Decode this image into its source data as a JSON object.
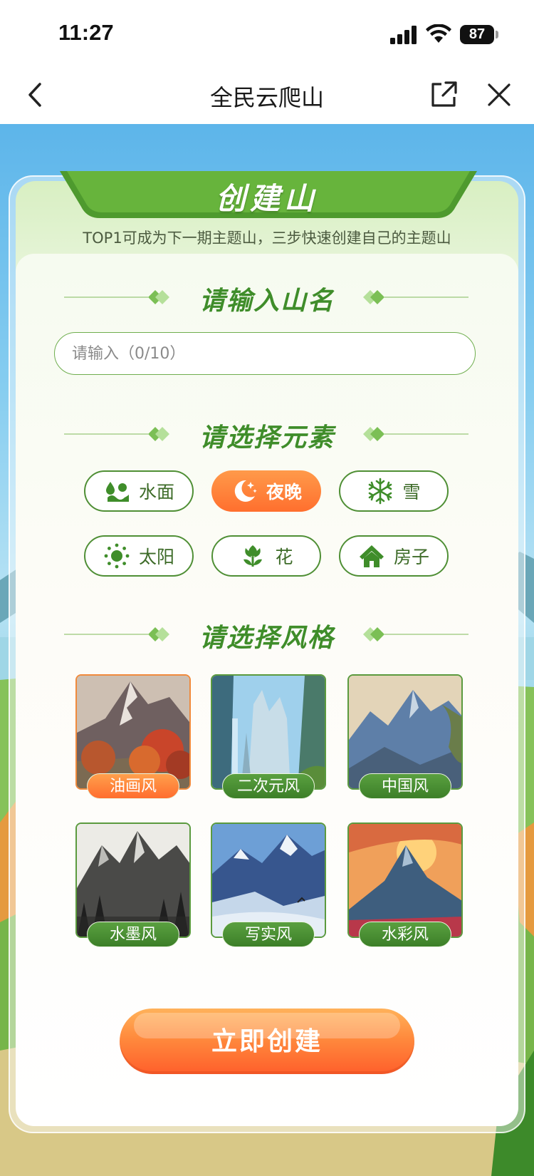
{
  "status_bar": {
    "time": "11:27",
    "battery": "87"
  },
  "nav": {
    "title": "全民云爬山"
  },
  "header": {
    "title": "创建山",
    "subtitle": "TOP1可成为下一期主题山，三步快速创建自己的主题山"
  },
  "name_section": {
    "title": "请输入山名",
    "input_placeholder": "请输入（0/10）",
    "input_value": ""
  },
  "element_section": {
    "title": "请选择元素",
    "selected": "夜晚",
    "chips": [
      {
        "label": "水面",
        "icon": "water-icon"
      },
      {
        "label": "夜晚",
        "icon": "moon-icon"
      },
      {
        "label": "雪",
        "icon": "snowflake-icon"
      },
      {
        "label": "太阳",
        "icon": "sun-icon"
      },
      {
        "label": "花",
        "icon": "flower-icon"
      },
      {
        "label": "房子",
        "icon": "house-icon"
      }
    ]
  },
  "style_section": {
    "title": "请选择风格",
    "selected": "油画风",
    "styles": [
      {
        "label": "油画风"
      },
      {
        "label": "二次元风"
      },
      {
        "label": "中国风"
      },
      {
        "label": "水墨风"
      },
      {
        "label": "写实风"
      },
      {
        "label": "水彩风"
      }
    ]
  },
  "create_button": {
    "label": "立即创建"
  },
  "colors": {
    "primary_green": "#3f8d2a",
    "accent_orange": "#ff6f2e",
    "sky_blue": "#5db5ea"
  }
}
